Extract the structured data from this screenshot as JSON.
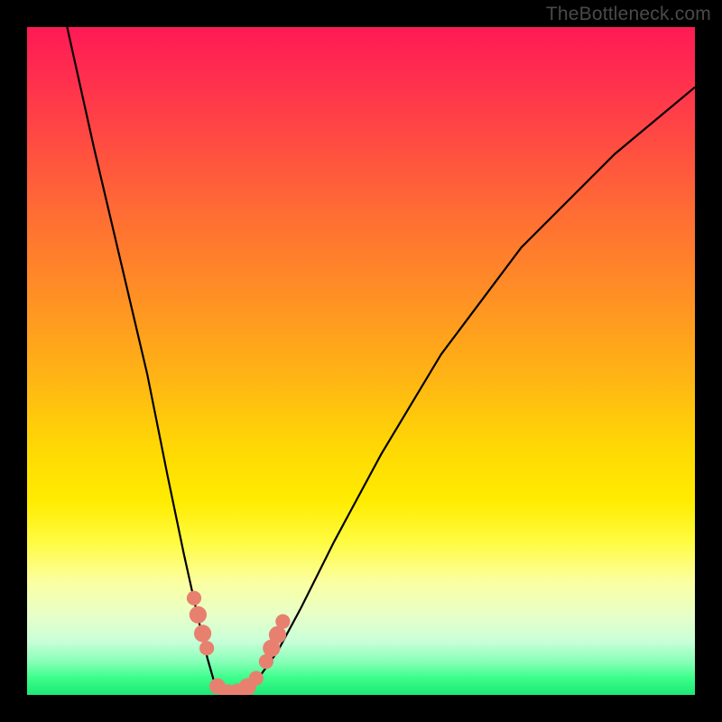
{
  "watermark": "TheBottleneck.com",
  "chart_data": {
    "type": "line",
    "title": "",
    "xlabel": "",
    "ylabel": "",
    "xlim": [
      0,
      100
    ],
    "ylim": [
      0,
      100
    ],
    "series": [
      {
        "name": "curve",
        "x": [
          6,
          10,
          14,
          18,
          21,
          23.5,
          25.5,
          27,
          28,
          29,
          30,
          31.5,
          33,
          35,
          37.5,
          41,
          46,
          53,
          62,
          74,
          88,
          100
        ],
        "values": [
          100,
          82,
          65,
          48,
          33,
          21,
          12,
          5.5,
          2,
          0.2,
          0.1,
          0.3,
          1.2,
          3,
          6.5,
          13,
          23,
          36,
          51,
          67,
          81,
          91
        ]
      }
    ],
    "markers": [
      {
        "name": "bead",
        "x": 25.0,
        "y": 14.5,
        "r": 1.1
      },
      {
        "name": "bead",
        "x": 25.6,
        "y": 12.0,
        "r": 1.3
      },
      {
        "name": "bead",
        "x": 26.3,
        "y": 9.2,
        "r": 1.3
      },
      {
        "name": "bead",
        "x": 26.9,
        "y": 7.0,
        "r": 1.1
      },
      {
        "name": "bead",
        "x": 28.5,
        "y": 1.3,
        "r": 1.2
      },
      {
        "name": "bead",
        "x": 30.0,
        "y": 0.3,
        "r": 1.3
      },
      {
        "name": "bead",
        "x": 31.5,
        "y": 0.4,
        "r": 1.3
      },
      {
        "name": "bead",
        "x": 33.0,
        "y": 1.2,
        "r": 1.3
      },
      {
        "name": "bead",
        "x": 34.3,
        "y": 2.5,
        "r": 1.1
      },
      {
        "name": "bead",
        "x": 35.8,
        "y": 5.0,
        "r": 1.1
      },
      {
        "name": "bead",
        "x": 36.6,
        "y": 7.0,
        "r": 1.3
      },
      {
        "name": "bead",
        "x": 37.5,
        "y": 9.0,
        "r": 1.3
      },
      {
        "name": "bead",
        "x": 38.3,
        "y": 11.0,
        "r": 1.1
      }
    ],
    "colors": {
      "curve_stroke": "#000000",
      "bead_fill": "#e88070"
    }
  }
}
